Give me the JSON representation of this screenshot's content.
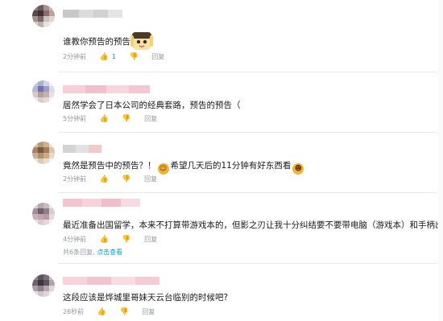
{
  "comments": [
    {
      "text": "谁教你预告的预告的",
      "time": "2分钟前",
      "likes": "1",
      "reply_label": "回复"
    },
    {
      "text": "居然学会了日本公司的经典套路，预告的预告（",
      "time": "5分钟前",
      "reply_label": "回复"
    },
    {
      "text_a": "竟然是预告中的预告？！",
      "text_b": "希望几天后的11分钟有好东西看",
      "time": "2分钟前",
      "reply_label": "回复"
    },
    {
      "text": "最近准备出国留学，本来不打算带游戏本的，但影之刃让我十分纠结要不要带电脑（游戏本）和手柄出去",
      "time": "4分钟前",
      "reply_label": "回复",
      "replies_text": "共6条回复,",
      "replies_link": "点击查看"
    },
    {
      "text": "这段应该是烨城里哥妹天云台临别的时候吧?",
      "time": "26秒前",
      "reply_label": "回复"
    }
  ],
  "icons": {
    "like": "thumb-up-icon",
    "dislike": "thumb-down-icon",
    "emoji_a": "laughing-emoji-icon",
    "emoji_b": "grinning-emoji-icon",
    "emoji_c": "tears-of-joy-emoji-icon"
  },
  "colors": {
    "meta_text": "#9499a0",
    "accent_blue": "#00a1d6",
    "username_pink": "#f4c2cf"
  }
}
